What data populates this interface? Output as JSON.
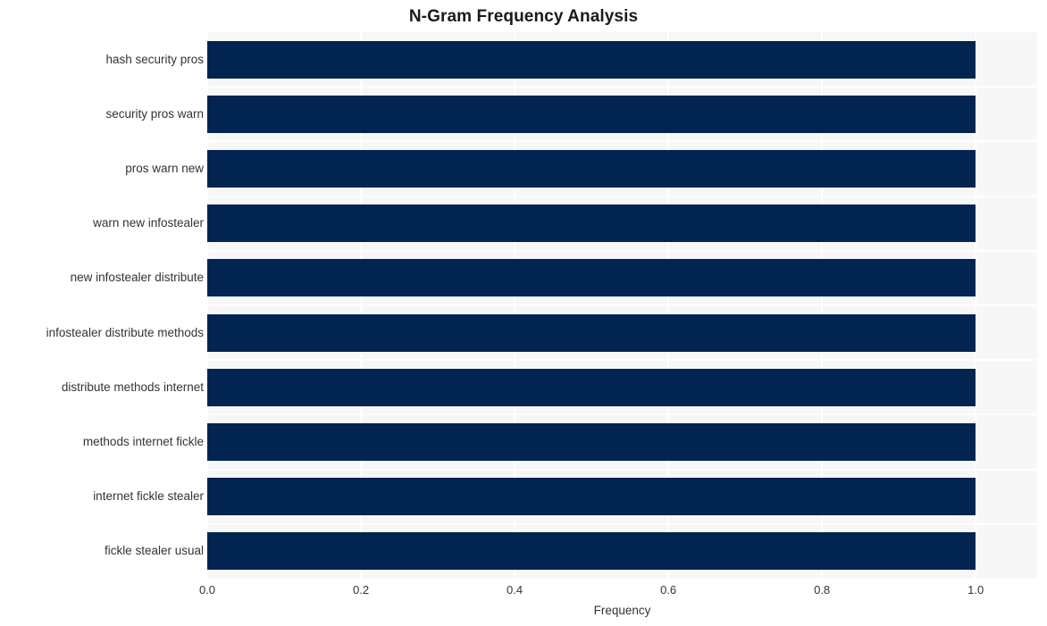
{
  "chart_data": {
    "type": "bar",
    "orientation": "horizontal",
    "title": "N-Gram Frequency Analysis",
    "xlabel": "Frequency",
    "ylabel": "",
    "categories": [
      "hash security pros",
      "security pros warn",
      "pros warn new",
      "warn new infostealer",
      "new infostealer distribute",
      "infostealer distribute methods",
      "distribute methods internet",
      "methods internet fickle",
      "internet fickle stealer",
      "fickle stealer usual"
    ],
    "values": [
      1.0,
      1.0,
      1.0,
      1.0,
      1.0,
      1.0,
      1.0,
      1.0,
      1.0,
      1.0
    ],
    "xlim": [
      0.0,
      1.08
    ],
    "xticks": [
      0.0,
      0.2,
      0.4,
      0.6,
      0.8,
      1.0
    ],
    "xtick_labels": [
      "0.0",
      "0.2",
      "0.4",
      "0.6",
      "0.8",
      "1.0"
    ],
    "grid": true,
    "legend": null,
    "bar_color": "#022450",
    "plot_background": "#f7f7f7",
    "grid_color": "#ffffff",
    "figure_background": "#ffffff",
    "text_color": "#333333",
    "title_color": "#1a1a1a"
  }
}
